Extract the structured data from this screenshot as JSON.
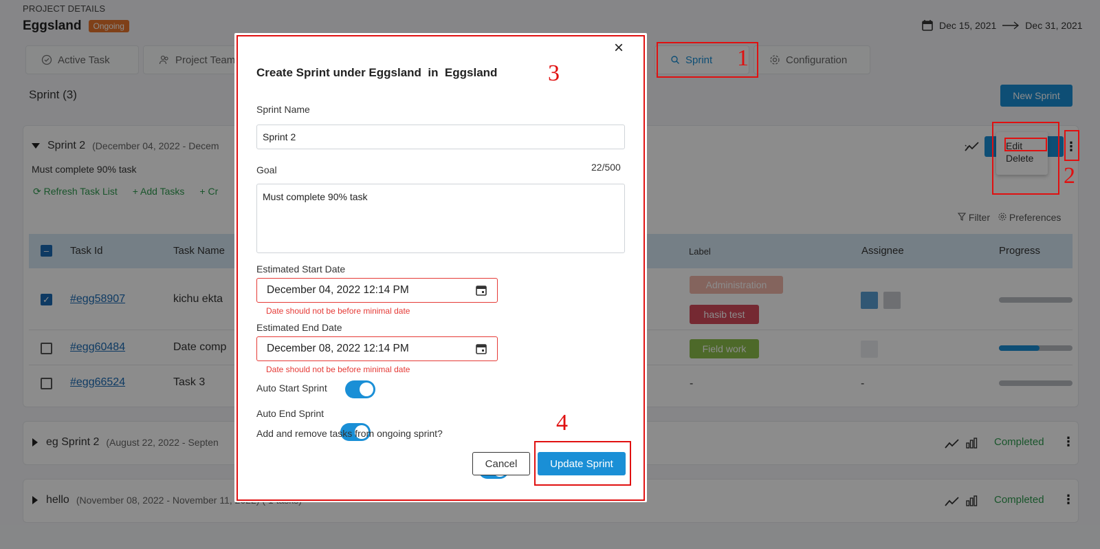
{
  "header": {
    "section_label": "PROJECT DETAILS",
    "project_name": "Eggsland",
    "status_badge": "Ongoing",
    "date_start": "Dec 15, 2021",
    "date_end": "Dec 31, 2021"
  },
  "tabs": [
    {
      "label": "Active Task"
    },
    {
      "label": "Project Team"
    },
    {
      "label": "Sprint"
    },
    {
      "label": "Configuration"
    }
  ],
  "sprint_section": {
    "title": "Sprint (3)",
    "new_sprint_label": "New Sprint",
    "filter_label": "Filter",
    "preferences_label": "Preferences"
  },
  "sprints": [
    {
      "name": "Sprint 2",
      "range": "(December 04, 2022 - Decem",
      "goal": "Must complete 90% task"
    },
    {
      "name": "eg Sprint 2",
      "range": "(August 22, 2022 - Septen",
      "status": "Completed"
    },
    {
      "name": "hello",
      "range": "(November 08, 2022 - November 11, 2022) ( 1 tasks)",
      "status": "Completed"
    }
  ],
  "sprint_actions": {
    "refresh": "Refresh Task List",
    "add_tasks": "Add Tasks",
    "create": "+ Cr"
  },
  "context_menu": {
    "edit": "Edit",
    "delete": "Delete"
  },
  "table": {
    "headers": {
      "task_id": "Task Id",
      "task_name": "Task Name",
      "label": "Label",
      "assignee": "Assignee",
      "progress": "Progress"
    },
    "rows": [
      {
        "id": "#egg58907",
        "name": "kichu ekta",
        "labels": [
          "Administration",
          "hasib test"
        ],
        "progress": 0
      },
      {
        "id": "#egg60484",
        "name": "Date comp",
        "labels": [
          "Field work"
        ],
        "progress": 0.55
      },
      {
        "id": "#egg66524",
        "name": "Task 3",
        "label_text": "-",
        "assignee_text": "-",
        "progress": 0
      }
    ]
  },
  "modal": {
    "title": "Create Sprint under Eggsland  in  Eggsland",
    "sprint_name_label": "Sprint Name",
    "sprint_name_value": "Sprint 2",
    "goal_label": "Goal",
    "goal_counter": "22/500",
    "goal_value": "Must complete 90% task",
    "start_label": "Estimated Start Date",
    "start_value": "December 04, 2022 12:14 PM",
    "start_error": "Date should not be before minimal date",
    "end_label": "Estimated End Date",
    "end_value": "December 08, 2022 12:14 PM",
    "end_error": "Date should not be before minimal date",
    "auto_start_label": "Auto Start Sprint",
    "auto_end_label": "Auto End Sprint",
    "add_remove_label": "Add and remove tasks from ongoing sprint?",
    "cancel_label": "Cancel",
    "update_label": "Update Sprint",
    "close_symbol": "×"
  },
  "annotations": [
    "1",
    "2",
    "3",
    "4"
  ],
  "colors": {
    "accent": "#1a8fd6",
    "badge": "#e8762c",
    "error": "#e53935",
    "annotation": "#e01010",
    "completed": "#2e9b4f",
    "label_administration": "#f0b7a9",
    "label_hasib_test": "#d64b5c",
    "label_field_work": "#8cbf4b"
  }
}
